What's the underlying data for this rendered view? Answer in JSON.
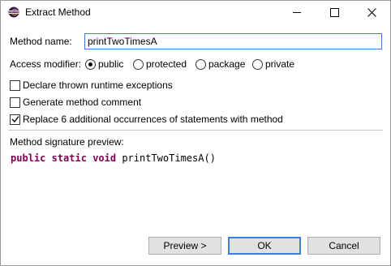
{
  "window": {
    "title": "Extract Method",
    "controls": {
      "minimize": "minimize",
      "maximize": "maximize",
      "close": "close"
    }
  },
  "form": {
    "method_name_label": "Method name:",
    "method_name_value": "printTwoTimesA",
    "access_modifier_label": "Access modifier:",
    "access_options": [
      {
        "label": "public",
        "selected": true
      },
      {
        "label": "protected",
        "selected": false
      },
      {
        "label": "package",
        "selected": false
      },
      {
        "label": "private",
        "selected": false
      }
    ],
    "options": [
      {
        "label": "Declare thrown runtime exceptions",
        "checked": false
      },
      {
        "label": "Generate method comment",
        "checked": false
      },
      {
        "label": "Replace 6 additional occurrences of statements with method",
        "checked": true
      }
    ]
  },
  "preview": {
    "label": "Method signature preview:",
    "keywords": [
      "public",
      "static",
      "void"
    ],
    "signature": "printTwoTimesA()"
  },
  "buttons": {
    "preview": "Preview >",
    "ok": "OK",
    "cancel": "Cancel"
  },
  "colors": {
    "keyword": "#7f0055",
    "focus_border": "#3a7bd5",
    "default_button_border": "#3c7fd6",
    "button_face": "#e1e1e1"
  }
}
